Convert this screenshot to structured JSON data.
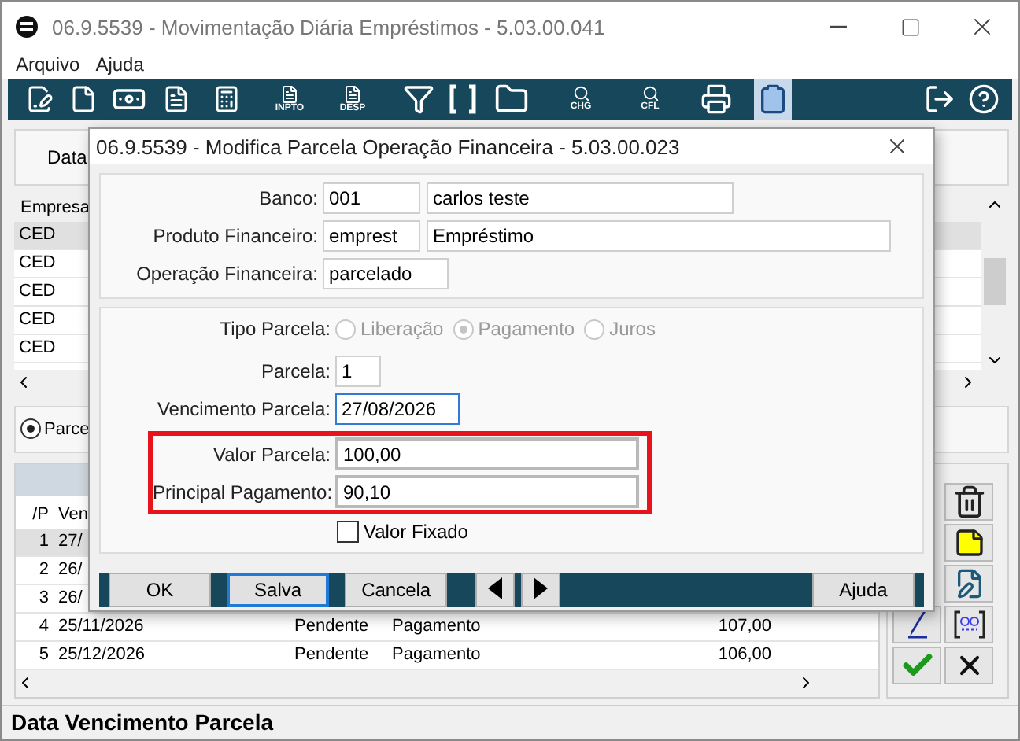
{
  "window": {
    "title": "06.9.5539 - Movimentação Diária Empréstimos - 5.03.00.041"
  },
  "menu": [
    "Arquivo",
    "Ajuda"
  ],
  "toolbar": [
    {
      "kind": "edit",
      "active": false
    },
    {
      "kind": "file",
      "active": false
    },
    {
      "kind": "money",
      "active": false
    },
    {
      "kind": "percent",
      "active": false
    },
    {
      "kind": "calculator",
      "active": false
    },
    {
      "kind": "doc",
      "label": "INPTO",
      "active": false
    },
    {
      "kind": "doc",
      "label": "DESP",
      "active": false
    },
    {
      "kind": "filter",
      "active": false
    },
    {
      "kind": "brackets",
      "active": false
    },
    {
      "kind": "folder",
      "active": false
    },
    {
      "kind": "find",
      "label": "CHG",
      "active": false
    },
    {
      "kind": "find",
      "label": "CFL",
      "active": false
    },
    {
      "kind": "printer",
      "active": false
    },
    {
      "kind": "clipboard",
      "active": true
    },
    {
      "kind": "exit",
      "active": false
    },
    {
      "kind": "help",
      "active": false
    }
  ],
  "filter_panel": {
    "label": "Data"
  },
  "companies": {
    "column": "Empresa",
    "rows": [
      {
        "text": "CED",
        "selected": true
      },
      {
        "text": "CED",
        "selected": false
      },
      {
        "text": "CED",
        "selected": false
      },
      {
        "text": "CED",
        "selected": false
      },
      {
        "text": "CED",
        "selected": false
      }
    ]
  },
  "option": {
    "label": "Parce",
    "selected": true
  },
  "installments": {
    "columns": [
      "/P",
      "Ven"
    ],
    "rows": [
      {
        "number": "1",
        "date": "27/",
        "selected": true
      },
      {
        "number": "2",
        "date": "26/",
        "selected": false
      },
      {
        "number": "3",
        "date": "26/",
        "selected": false
      },
      {
        "number": "4",
        "date": "25/11/2026",
        "status": "Pendente",
        "type": "Pagamento",
        "value": "107,00",
        "selected": false
      },
      {
        "number": "5",
        "date": "25/12/2026",
        "status": "Pendente",
        "type": "Pagamento",
        "value": "106,00",
        "selected": false
      }
    ]
  },
  "side_buttons": [
    {
      "kind": "trash"
    },
    {
      "kind": "note"
    },
    {
      "kind": "calc"
    },
    {
      "kind": "mark"
    },
    {
      "kind": "range"
    },
    {
      "kind": "confirm"
    },
    {
      "kind": "cancel"
    }
  ],
  "status_bar": "Data Vencimento Parcela",
  "dialog": {
    "title": "06.9.5539 - Modifica Parcela Operação Financeira - 5.03.00.023",
    "header_fields": [
      {
        "label": "Banco:",
        "values": [
          {
            "text": "001",
            "kind": "code"
          },
          {
            "text": "carlos teste",
            "kind": "name"
          }
        ]
      },
      {
        "label": "Produto Financeiro:",
        "values": [
          {
            "text": "emprest",
            "kind": "code"
          },
          {
            "text": "Empréstimo",
            "kind": "long"
          }
        ]
      },
      {
        "label": "Operação Financeira:",
        "values": [
          {
            "text": "parcelado",
            "kind": "medium"
          }
        ]
      }
    ],
    "tipo_parcela": {
      "label": "Tipo Parcela:",
      "options": [
        {
          "label": "Liberação",
          "selected": false,
          "disabled": true
        },
        {
          "label": "Pagamento",
          "selected": true,
          "disabled": true
        },
        {
          "label": "Juros",
          "selected": false,
          "disabled": true
        }
      ]
    },
    "fields": [
      {
        "label": "Parcela:",
        "value": "1",
        "kind": "short",
        "focused": false
      },
      {
        "label": "Vencimento Parcela:",
        "value": "27/08/2026",
        "kind": "date",
        "focused": true
      }
    ],
    "highlighted_fields": [
      {
        "label": "Valor Parcela:",
        "value": "100,00",
        "kind": "wide",
        "focused": false
      },
      {
        "label": "Principal Pagamento:",
        "value": "90,10",
        "kind": "wide",
        "focused": false
      }
    ],
    "checkbox": {
      "label": "Valor Fixado",
      "checked": false
    },
    "buttons": [
      {
        "kind": "text",
        "label": "OK",
        "focused": false
      },
      {
        "kind": "text",
        "label": "Salva",
        "focused": true
      },
      {
        "kind": "text",
        "label": "Cancela",
        "focused": false
      },
      {
        "kind": "prev"
      },
      {
        "kind": "next"
      },
      {
        "kind": "text",
        "label": "Ajuda",
        "focused": false
      }
    ]
  }
}
